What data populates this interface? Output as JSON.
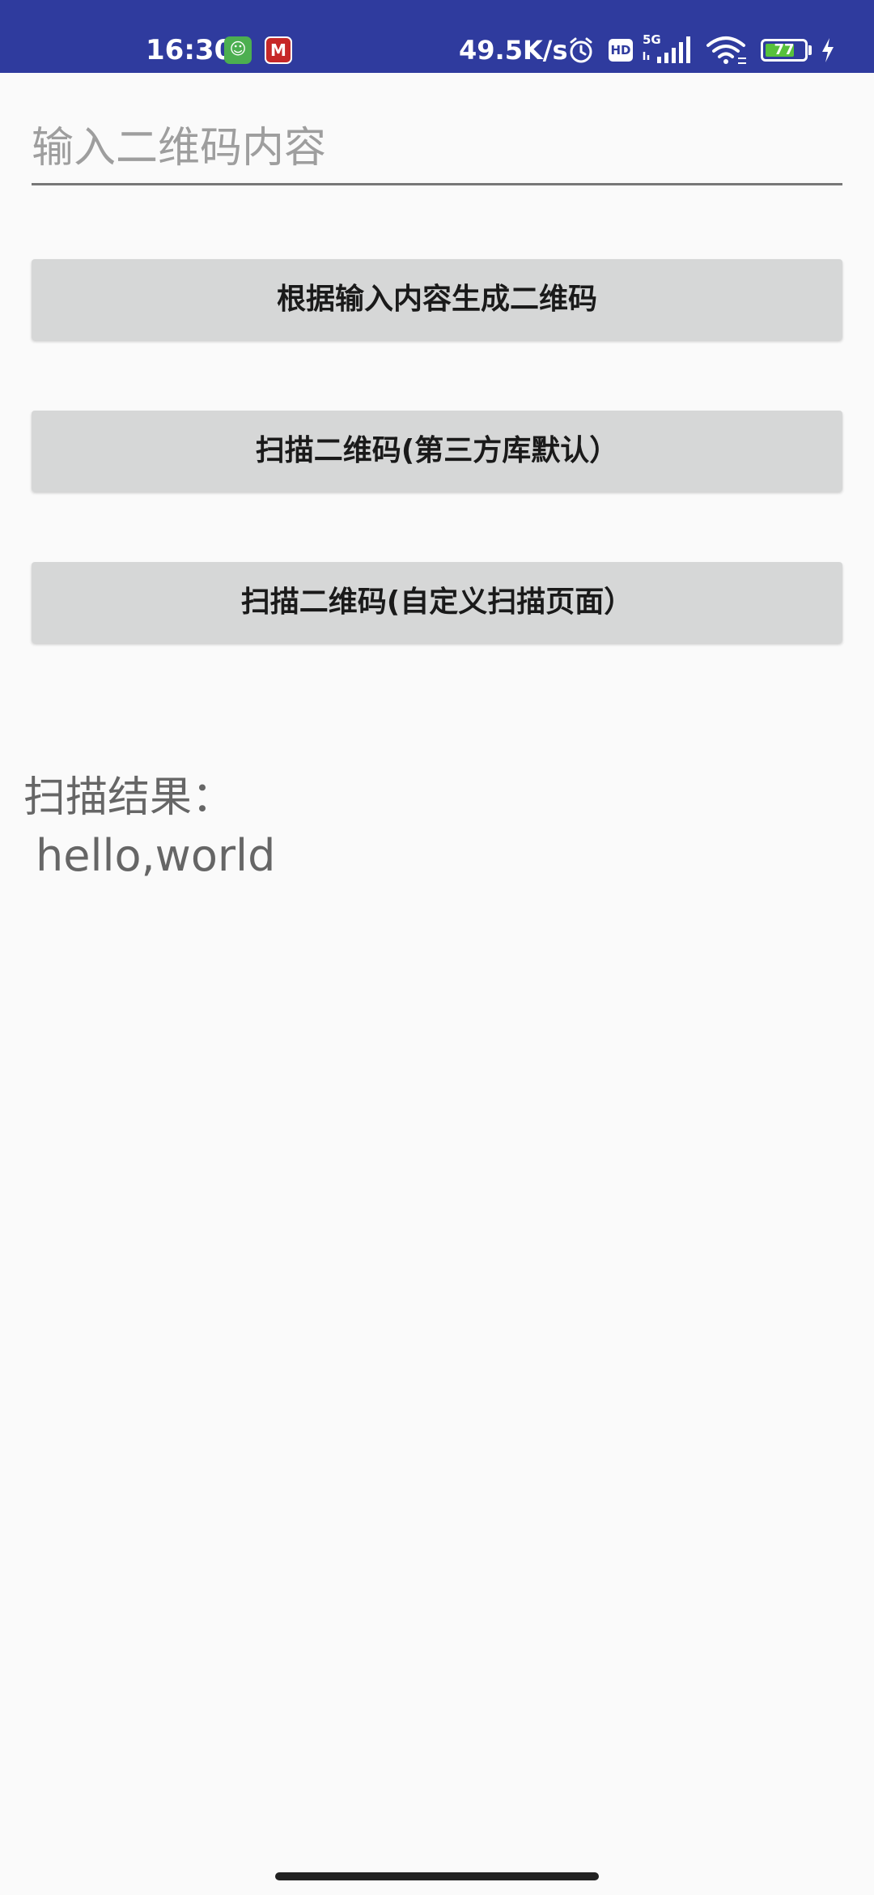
{
  "status_bar": {
    "time": "16:30",
    "net_speed": "49.5K/s",
    "hd_label": "HD",
    "network_type": "5G",
    "battery_level": "77",
    "battery_percent": 77,
    "background_color": "#2f3b9e"
  },
  "input": {
    "placeholder": "输入二维码内容",
    "value": ""
  },
  "buttons": {
    "generate": "根据输入内容生成二维码",
    "scan_default": "扫描二维码(第三方库默认）",
    "scan_custom": "扫描二维码(自定义扫描页面）"
  },
  "result": {
    "label": "扫描结果：",
    "value": "hello,world"
  }
}
